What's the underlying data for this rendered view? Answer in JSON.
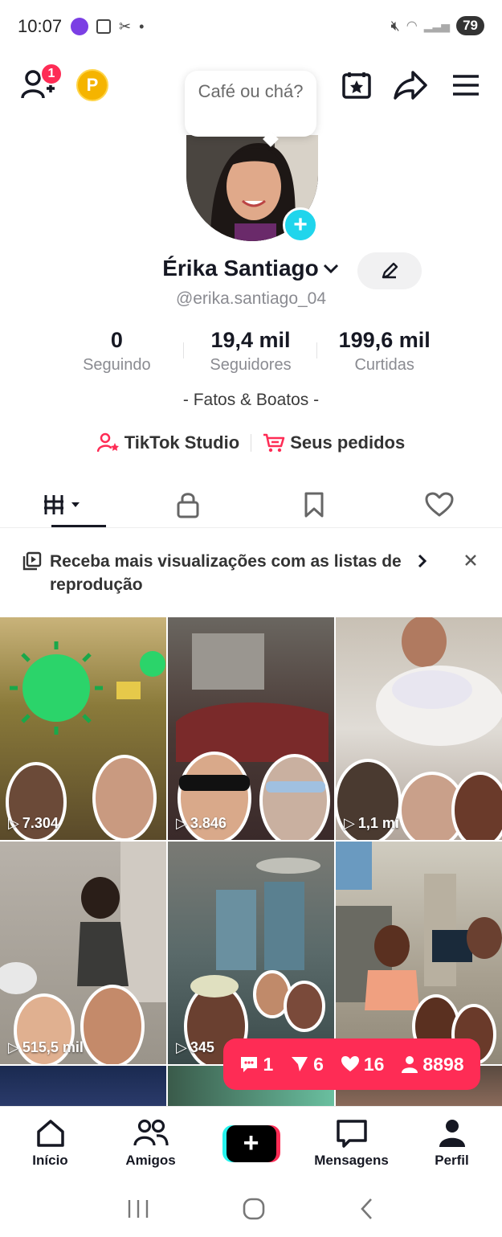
{
  "status_bar": {
    "time": "10:07",
    "battery": "79"
  },
  "header": {
    "friends_badge": "1",
    "coin_letter": "P",
    "note_bubble": "Café ou chá?"
  },
  "profile": {
    "name": "Érika Santiago",
    "handle": "@erika.santiago_04",
    "bio": "- Fatos & Boatos -"
  },
  "stats": [
    {
      "value": "0",
      "label": "Seguindo"
    },
    {
      "value": "19,4 mil",
      "label": "Seguidores"
    },
    {
      "value": "199,6 mil",
      "label": "Curtidas"
    }
  ],
  "links": {
    "studio": "TikTok Studio",
    "orders": "Seus pedidos"
  },
  "banner": {
    "text": "Receba mais visualizações com as listas de reprodução"
  },
  "videos": [
    {
      "views": "7.304"
    },
    {
      "views": "3.846"
    },
    {
      "views": "1,1 mi"
    },
    {
      "views": "515,5 mil"
    },
    {
      "views": "345"
    },
    {
      "views": ""
    }
  ],
  "live_pill": {
    "comments": "1",
    "shares": "6",
    "likes": "16",
    "viewers": "8898"
  },
  "nav": {
    "home": "Início",
    "friends": "Amigos",
    "messages": "Mensagens",
    "profile": "Perfil"
  },
  "colors": {
    "accent": "#fe2c55",
    "cyan": "#25f4ee",
    "text": "#161823",
    "muted": "#8a8b91"
  }
}
